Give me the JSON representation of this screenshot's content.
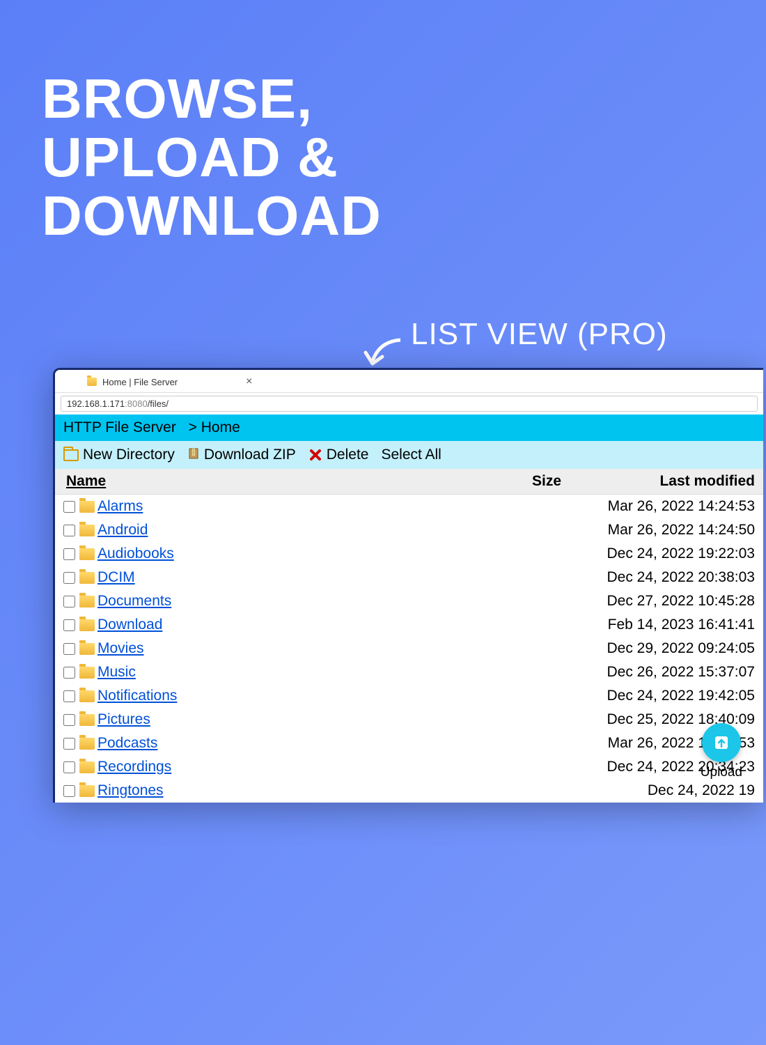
{
  "hero": {
    "line1": "BROWSE,",
    "line2": "UPLOAD &",
    "line3": "DOWNLOAD"
  },
  "callout": "LIST VIEW (PRO)",
  "tab": {
    "title": "Home | File Server"
  },
  "address": {
    "host": "192.168.1.171",
    "port": ":8080",
    "path": "/files/"
  },
  "header": {
    "server_name": "HTTP File Server",
    "breadcrumb": "> Home"
  },
  "toolbar": {
    "new_dir": "New Directory",
    "download_zip": "Download ZIP",
    "delete": "Delete",
    "select_all": "Select All"
  },
  "columns": {
    "name": "Name",
    "size": "Size",
    "modified": "Last modified"
  },
  "files": [
    {
      "name": "Alarms",
      "modified": "Mar 26, 2022 14:24:53"
    },
    {
      "name": "Android",
      "modified": "Mar 26, 2022 14:24:50"
    },
    {
      "name": "Audiobooks",
      "modified": "Dec 24, 2022 19:22:03"
    },
    {
      "name": "DCIM",
      "modified": "Dec 24, 2022 20:38:03"
    },
    {
      "name": "Documents",
      "modified": "Dec 27, 2022 10:45:28"
    },
    {
      "name": "Download",
      "modified": "Feb 14, 2023 16:41:41"
    },
    {
      "name": "Movies",
      "modified": "Dec 29, 2022 09:24:05"
    },
    {
      "name": "Music",
      "modified": "Dec 26, 2022 15:37:07"
    },
    {
      "name": "Notifications",
      "modified": "Dec 24, 2022 19:42:05"
    },
    {
      "name": "Pictures",
      "modified": "Dec 25, 2022 18:40:09"
    },
    {
      "name": "Podcasts",
      "modified": "Mar 26, 2022 14:24:53"
    },
    {
      "name": "Recordings",
      "modified": "Dec 24, 2022 20:34:23"
    },
    {
      "name": "Ringtones",
      "modified": "Dec 24, 2022 19"
    }
  ],
  "upload_label": "Upload"
}
